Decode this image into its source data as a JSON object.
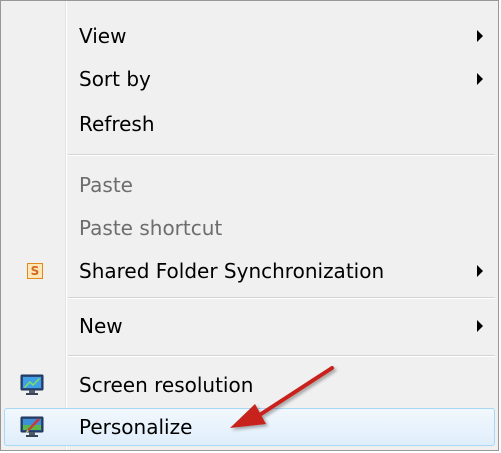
{
  "menu": {
    "items": [
      {
        "label": "View",
        "submenu": true,
        "disabled": false
      },
      {
        "label": "Sort by",
        "submenu": true,
        "disabled": false
      },
      {
        "label": "Refresh",
        "submenu": false,
        "disabled": false
      },
      {
        "label": "Paste",
        "submenu": false,
        "disabled": true
      },
      {
        "label": "Paste shortcut",
        "submenu": false,
        "disabled": true
      },
      {
        "label": "Shared Folder Synchronization",
        "submenu": true,
        "disabled": false,
        "icon": "shared-folder-sync-icon",
        "icon_glyph": "S"
      },
      {
        "label": "New",
        "submenu": true,
        "disabled": false
      },
      {
        "label": "Screen resolution",
        "submenu": false,
        "disabled": false,
        "icon": "screen-resolution-icon"
      },
      {
        "label": "Personalize",
        "submenu": false,
        "disabled": false,
        "icon": "personalize-icon",
        "highlighted": true
      }
    ]
  },
  "colors": {
    "menu_background": "#f0f0f0",
    "disabled_text": "#6d6d6d",
    "highlight_border": "#a8d8f6",
    "annotation_arrow": "#c8201e"
  }
}
